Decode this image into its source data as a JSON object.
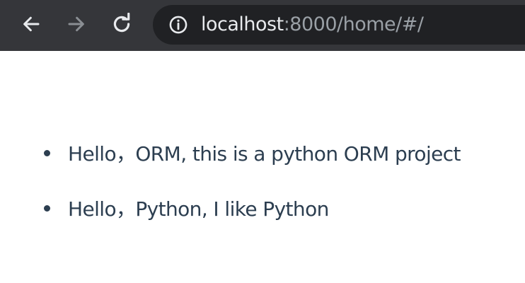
{
  "browser": {
    "url_host": "localhost",
    "url_rest": ":8000/home/#/"
  },
  "list": {
    "items": [
      "Hello，ORM, this is a python ORM project",
      "Hello，Python, I like Python"
    ]
  },
  "colors": {
    "toolbar_bg": "#35363a",
    "address_bg": "#202124",
    "text": "#2c3e50"
  },
  "icons": {
    "back": "arrow-left-icon",
    "forward": "arrow-right-icon",
    "reload": "reload-icon",
    "info": "info-icon"
  }
}
